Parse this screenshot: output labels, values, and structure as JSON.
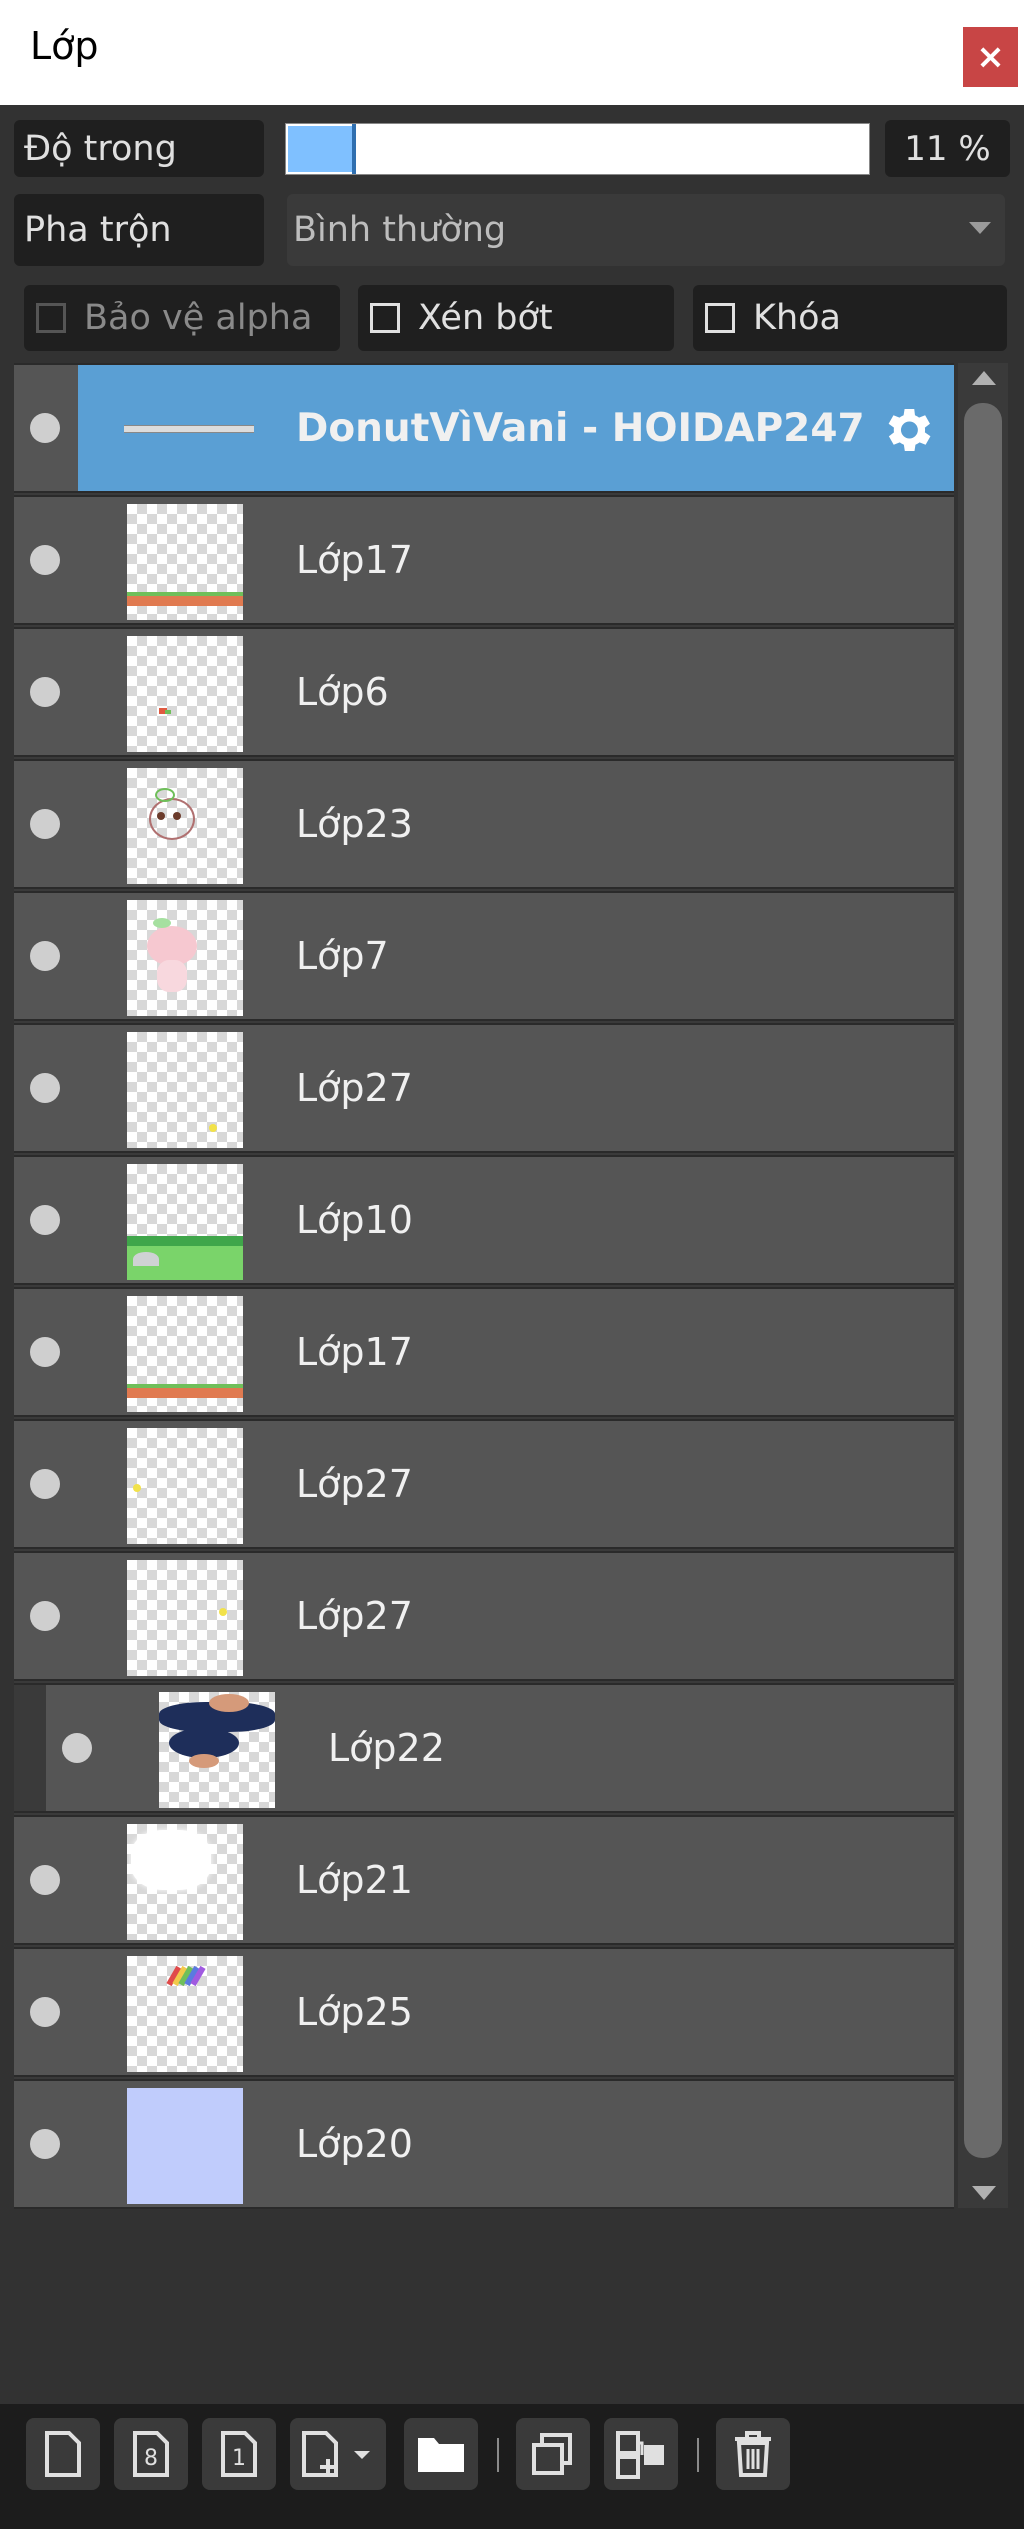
{
  "window": {
    "title": "Lớp",
    "close_label": "×"
  },
  "opacity": {
    "label": "Độ trong",
    "value_text": "11 %",
    "value": 0.11
  },
  "blend": {
    "label": "Pha trộn",
    "selected": "Bình thường"
  },
  "checkboxes": {
    "alpha": {
      "label": "Bảo vệ alpha",
      "checked": false,
      "disabled": true
    },
    "clip": {
      "label": "Xén bớt",
      "checked": false
    },
    "lock": {
      "label": "Khóa",
      "checked": false
    }
  },
  "layers": [
    {
      "name": "DonutVìVani - HOIDAP247",
      "selected": true
    },
    {
      "name": "Lớp17"
    },
    {
      "name": "Lớp6"
    },
    {
      "name": "Lớp23"
    },
    {
      "name": "Lớp7"
    },
    {
      "name": "Lớp27"
    },
    {
      "name": "Lớp10"
    },
    {
      "name": "Lớp17"
    },
    {
      "name": "Lớp27"
    },
    {
      "name": "Lớp27"
    },
    {
      "name": "Lớp22",
      "clipped": true
    },
    {
      "name": "Lớp21"
    },
    {
      "name": "Lớp25"
    },
    {
      "name": "Lớp20"
    }
  ],
  "toolbar": {
    "icons": [
      "new-layer-icon",
      "new-8bit-layer-icon",
      "new-1bit-layer-icon",
      "add-layer-menu-icon",
      "new-folder-icon",
      "duplicate-layer-icon",
      "merge-layer-icon",
      "delete-layer-icon"
    ]
  },
  "colors": {
    "selected": "#5a9fd4",
    "row": "#555555",
    "panel": "#323232",
    "close": "#c84545"
  }
}
